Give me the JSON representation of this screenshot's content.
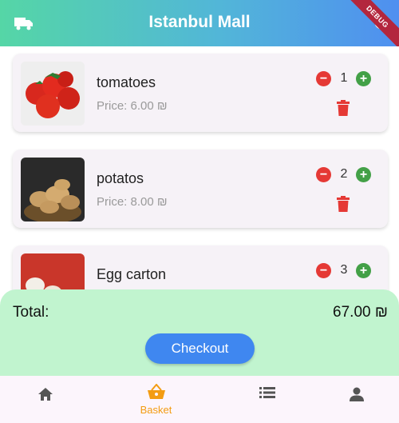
{
  "app": {
    "title": "Istanbul Mall",
    "debug_label": "DEBUG"
  },
  "basket": {
    "items": [
      {
        "name": "tomatoes",
        "price": "Price: 6.00 ₪",
        "quantity": "1"
      },
      {
        "name": "potatos",
        "price": "Price: 8.00 ₪",
        "quantity": "2"
      },
      {
        "name": "Egg carton",
        "price": "",
        "quantity": "3"
      }
    ],
    "total_label": "Total:",
    "total_value": "67.00 ₪",
    "checkout_label": "Checkout"
  },
  "nav": {
    "items": [
      {
        "icon": "home-icon",
        "label": ""
      },
      {
        "icon": "basket-icon",
        "label": "Basket"
      },
      {
        "icon": "list-icon",
        "label": ""
      },
      {
        "icon": "person-icon",
        "label": ""
      }
    ],
    "active_index": 1
  },
  "colors": {
    "accent": "#3f87f0",
    "active_nav": "#f39c12",
    "minus": "#e53935",
    "plus": "#43a047",
    "panel": "#c1f4cf"
  }
}
